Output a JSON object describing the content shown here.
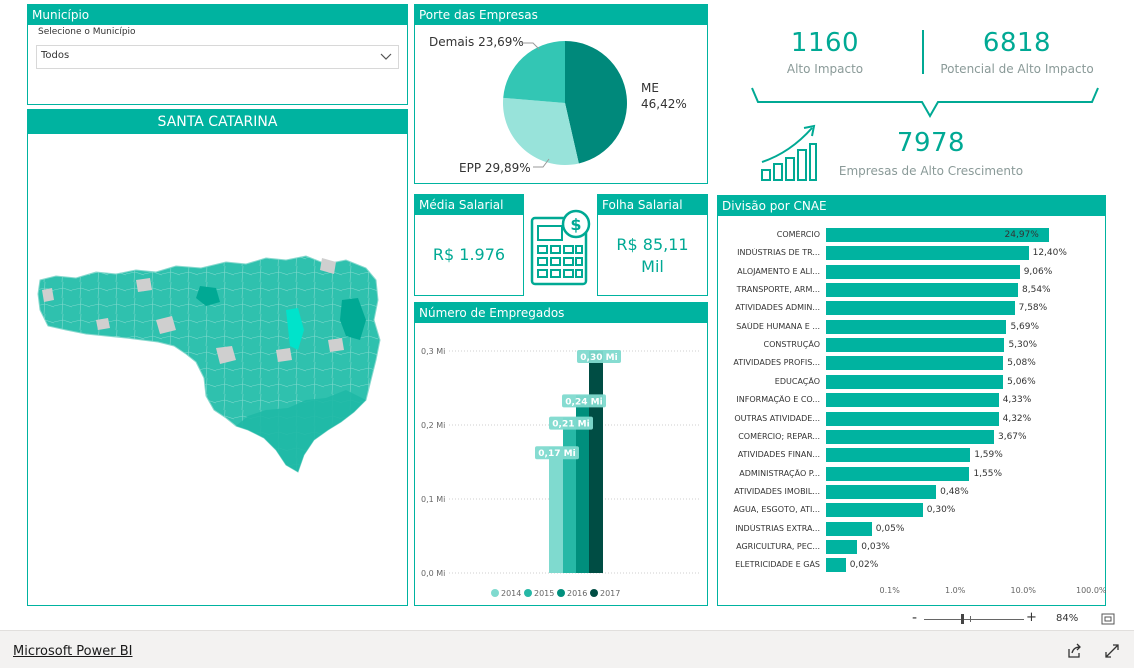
{
  "municipio": {
    "title": "Município",
    "label": "Selecione o Município",
    "selected": "Todos"
  },
  "map": {
    "title": "SANTA CATARINA"
  },
  "porte": {
    "title": "Porte das Empresas",
    "label_demais": "Demais 23,69%",
    "label_me_1": "ME",
    "label_me_2": "46,42%",
    "label_epp": "EPP 29,89%"
  },
  "kpis": {
    "alto_impacto_value": "1160",
    "alto_impacto_label": "Alto Impacto",
    "potencial_value": "6818",
    "potencial_label": "Potencial de Alto Impacto",
    "crescimento_value": "7978",
    "crescimento_label": "Empresas de Alto Crescimento"
  },
  "media_salarial": {
    "title": "Média Salarial",
    "value": "R$ 1.976"
  },
  "folha_salarial": {
    "title": "Folha Salarial",
    "value_1": "R$ 85,11",
    "value_2": "Mil"
  },
  "empregados": {
    "title": "Número de Empregados",
    "yticks": [
      "0,3 Mi",
      "0,2 Mi",
      "0,1 Mi",
      "0,0 Mi"
    ],
    "bar_labels": [
      "0,17 Mi",
      "0,21 Mi",
      "0,24 Mi",
      "0,30 Mi"
    ],
    "legend": [
      "2014",
      "2015",
      "2016",
      "2017"
    ]
  },
  "cnae": {
    "title": "Divisão por CNAE",
    "xticks": [
      "0.1%",
      "1.0%",
      "10.0%",
      "100.0%"
    ]
  },
  "footer": {
    "brand": "Microsoft Power BI",
    "zoom_minus": "-",
    "zoom_plus": "+",
    "zoom_level": "84%"
  },
  "colors": {
    "accent": "#00b3a0",
    "pie_me": "#00897b",
    "pie_epp": "#98e3da",
    "pie_demais": "#33c6b4",
    "y2014": "#7fdacf",
    "y2015": "#26b8a6",
    "y2016": "#008f7d",
    "y2017": "#004d44"
  },
  "chart_data": [
    {
      "type": "pie",
      "title": "Porte das Empresas",
      "categories": [
        "ME",
        "EPP",
        "Demais"
      ],
      "values": [
        46.42,
        29.89,
        23.69
      ]
    },
    {
      "type": "bar",
      "title": "Número de Empregados",
      "categories": [
        "2014",
        "2015",
        "2016",
        "2017"
      ],
      "values": [
        0.17,
        0.21,
        0.24,
        0.3
      ],
      "ylim": [
        0,
        0.3
      ]
    },
    {
      "type": "bar",
      "title": "Divisão por CNAE",
      "categories": [
        "COMÉRCIO",
        "INDÚSTRIAS DE TR...",
        "ALOJAMENTO E ALI...",
        "TRANSPORTE, ARM...",
        "ATIVIDADES ADMIN...",
        "SAÚDE HUMANA E ...",
        "CONSTRUÇÃO",
        "ATIVIDADES PROFIS...",
        "EDUCAÇÃO",
        "INFORMAÇÃO E CO...",
        "OUTRAS ATIVIDADE...",
        "COMÉRCIO; REPAR...",
        "ATIVIDADES FINAN...",
        "ADMINISTRAÇÃO P...",
        "ATIVIDADES IMOBIL...",
        "ÁGUA, ESGOTO, ATI...",
        "INDÚSTRIAS EXTRA...",
        "AGRICULTURA, PEC...",
        "ELETRICIDADE E GÁS"
      ],
      "values": [
        24.97,
        12.4,
        9.06,
        8.54,
        7.58,
        5.69,
        5.3,
        5.08,
        5.06,
        4.33,
        4.32,
        3.67,
        1.59,
        1.55,
        0.48,
        0.3,
        0.05,
        0.03,
        0.02
      ],
      "value_labels": [
        "24,97%",
        "12,40%",
        "9,06%",
        "8,54%",
        "7,58%",
        "5,69%",
        "5,30%",
        "5,08%",
        "5,06%",
        "4,33%",
        "4,32%",
        "3,67%",
        "1,59%",
        "1,55%",
        "0,48%",
        "0,30%",
        "0,05%",
        "0,03%",
        "0,02%"
      ],
      "xscale": "log"
    }
  ]
}
